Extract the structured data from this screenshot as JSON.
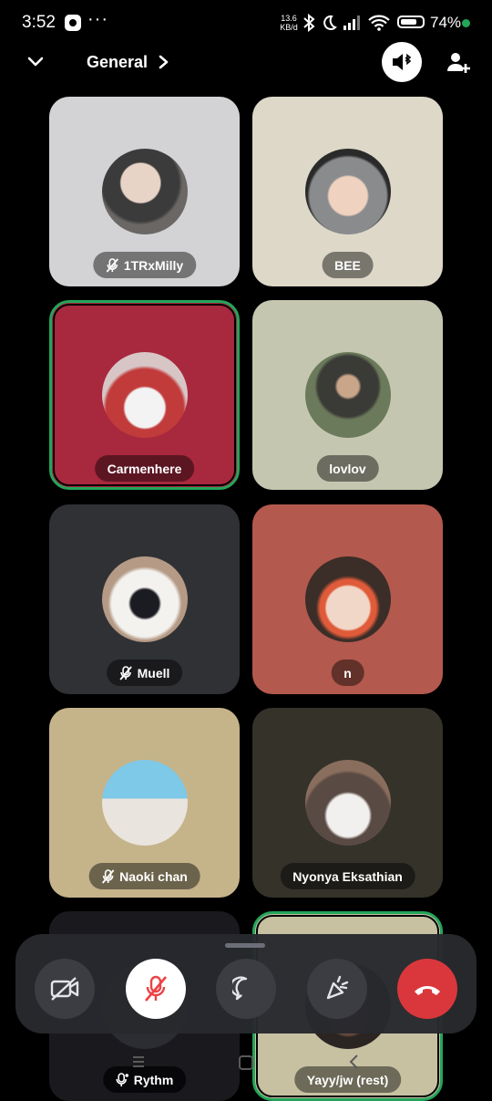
{
  "status_bar": {
    "time": "3:52",
    "dots": "···",
    "net_speed_value": "13.6",
    "net_speed_unit": "KB/d",
    "battery": "74%"
  },
  "header": {
    "title": "General"
  },
  "tiles": [
    {
      "name": "1TRxMilly",
      "muted": true,
      "bg": "#d3d3d6"
    },
    {
      "name": "BEE",
      "muted": false,
      "bg": "#ddd8c8"
    },
    {
      "name": "Carmenhere",
      "muted": false,
      "speaking": true,
      "bg": "#a8283e"
    },
    {
      "name": "lovlov",
      "muted": false,
      "bg": "#c5c6b0"
    },
    {
      "name": "Muell",
      "muted": true,
      "bg": "#303134"
    },
    {
      "name": "n",
      "muted": false,
      "bg": "#b3594e"
    },
    {
      "name": "Naoki chan",
      "muted": true,
      "bg": "#c5b48a"
    },
    {
      "name": "Nyonya Eksathian",
      "muted": false,
      "bg": "#35322a"
    },
    {
      "name": "Rythm",
      "muted": false,
      "bot": true,
      "bg": "#1a1a1e"
    },
    {
      "name": "Yayy/jw (rest)",
      "muted": false,
      "speaking": true,
      "bg": "#c7c1a2"
    }
  ],
  "colors": {
    "speaking_ring": "#23a55a",
    "end_call": "#da373c",
    "mute_active": "#ed4245"
  },
  "icons": [
    "camera-off-icon",
    "mic-off-icon",
    "chat-icon",
    "soundboard-icon",
    "end-call-icon"
  ]
}
